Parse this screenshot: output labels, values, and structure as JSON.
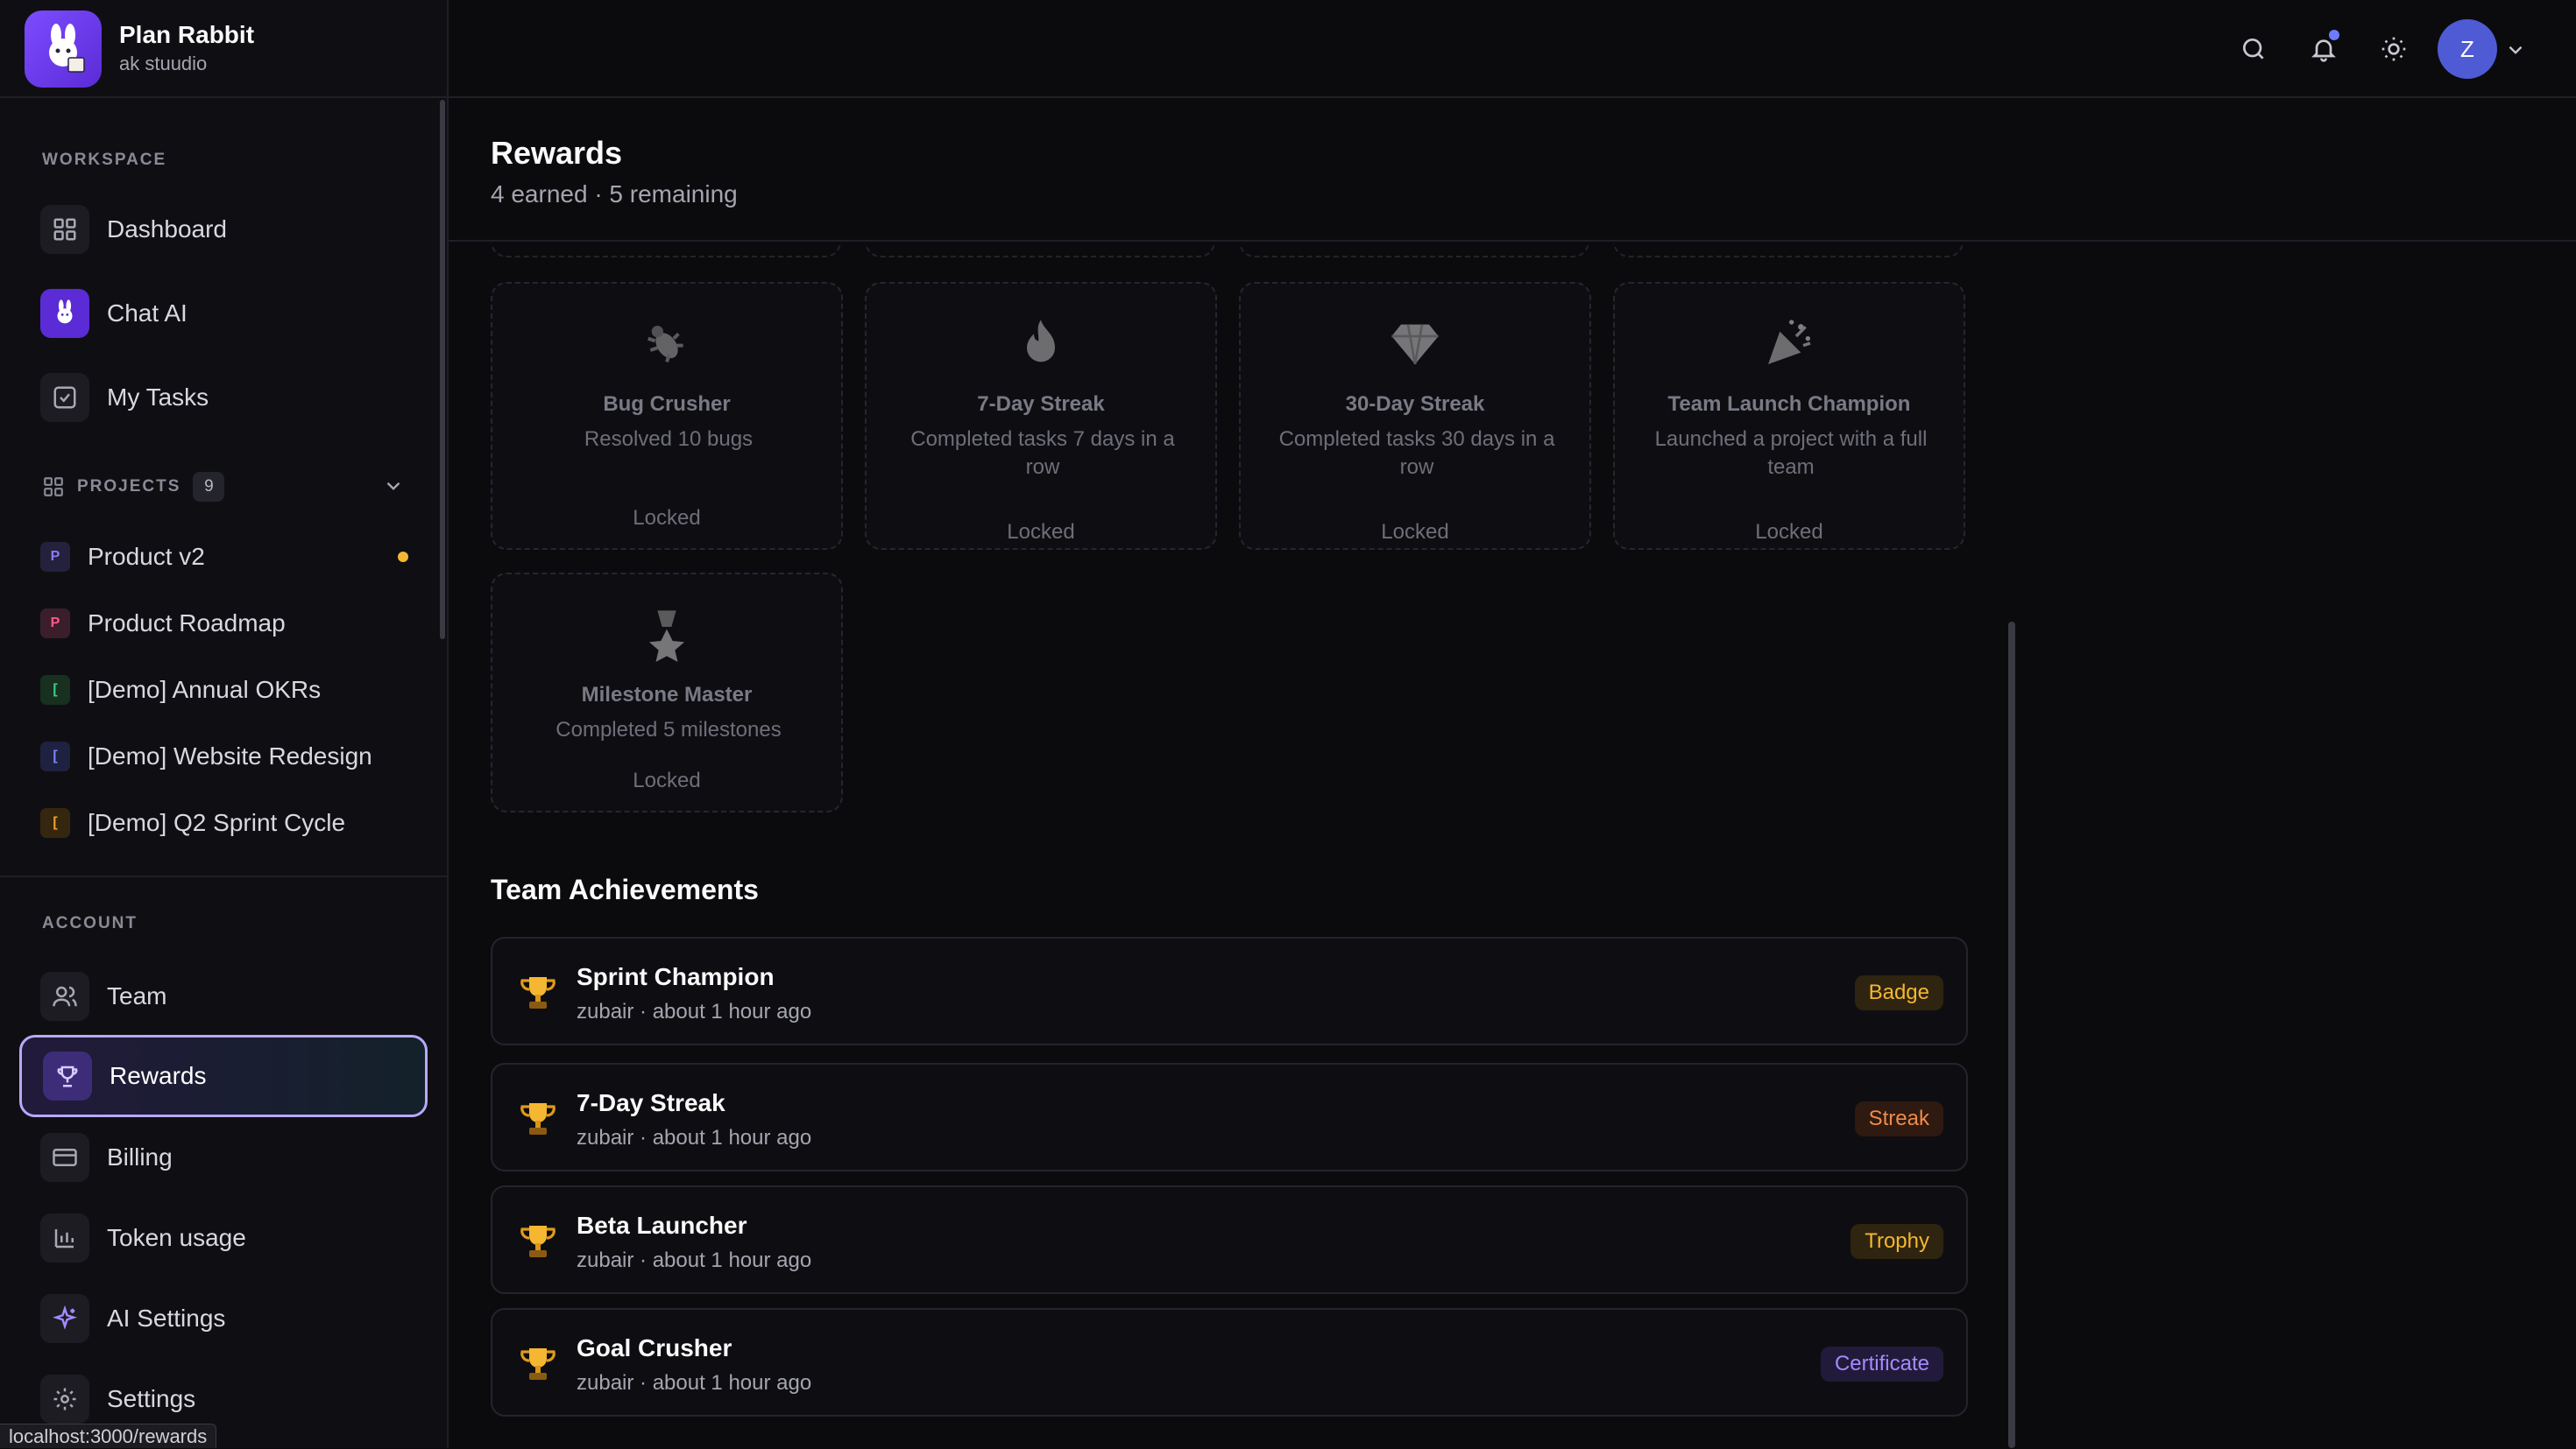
{
  "app": {
    "name": "Plan Rabbit",
    "workspace_name": "ak stuudio"
  },
  "sidebar": {
    "workspace_label": "WORKSPACE",
    "workspace_items": [
      {
        "label": "Dashboard",
        "icon": "grid-icon"
      },
      {
        "label": "Chat AI",
        "icon": "rabbit-icon"
      },
      {
        "label": "My Tasks",
        "icon": "checkbox-icon"
      }
    ],
    "projects_label": "PROJECTS",
    "projects_count": "9",
    "projects": [
      {
        "initial": "P",
        "name": "Product v2",
        "chip_color": "#8b7bff",
        "chip_bg": "#24213d",
        "unread": true
      },
      {
        "initial": "P",
        "name": "Product Roadmap",
        "chip_color": "#ff5a8a",
        "chip_bg": "#3a1f2a",
        "unread": false
      },
      {
        "initial": "[",
        "name": "[Demo] Annual OKRs",
        "chip_color": "#3fd08a",
        "chip_bg": "#17301f",
        "unread": false
      },
      {
        "initial": "[",
        "name": "[Demo] Website Redesign",
        "chip_color": "#7c86ff",
        "chip_bg": "#1f2140",
        "unread": false
      },
      {
        "initial": "[",
        "name": "[Demo] Q2 Sprint Cycle",
        "chip_color": "#f5a524",
        "chip_bg": "#35270f",
        "unread": false
      }
    ],
    "account_label": "ACCOUNT",
    "account_items": [
      {
        "label": "Team",
        "icon": "users-icon"
      },
      {
        "label": "Rewards",
        "icon": "trophy-icon",
        "active": true
      },
      {
        "label": "Billing",
        "icon": "credit-card-icon"
      },
      {
        "label": "Token usage",
        "icon": "bar-chart-icon"
      },
      {
        "label": "AI Settings",
        "icon": "sparkles-icon"
      },
      {
        "label": "Settings",
        "icon": "gear-icon"
      }
    ]
  },
  "status_bar": {
    "url": "localhost:3000/rewards"
  },
  "topbar": {
    "avatar_initial": "Z"
  },
  "page": {
    "title": "Rewards",
    "subtitle": "4 earned · 5 remaining"
  },
  "badges": [
    {
      "title": "Bug Crusher",
      "description": "Resolved 10 bugs",
      "status": "Locked",
      "icon": "bug-icon"
    },
    {
      "title": "7-Day Streak",
      "description": "Completed tasks 7 days in a row",
      "status": "Locked",
      "icon": "fire-icon"
    },
    {
      "title": "30-Day Streak",
      "description": "Completed tasks 30 days in a row",
      "status": "Locked",
      "icon": "diamond-icon"
    },
    {
      "title": "Team Launch Champion",
      "description": "Launched a project with a full team",
      "status": "Locked",
      "icon": "party-popper-icon"
    },
    {
      "title": "Milestone Master",
      "description": "Completed 5 milestones",
      "status": "Locked",
      "icon": "medal-icon"
    }
  ],
  "team_achievements": {
    "title": "Team Achievements",
    "items": [
      {
        "title": "Sprint Champion",
        "meta": "zubair · about 1 hour ago",
        "badge": "Badge",
        "badge_color": "#f5b731",
        "badge_bg": "#2e2410"
      },
      {
        "title": "7-Day Streak",
        "meta": "zubair · about 1 hour ago",
        "badge": "Streak",
        "badge_color": "#f08a4b",
        "badge_bg": "#2e1a10"
      },
      {
        "title": "Beta Launcher",
        "meta": "zubair · about 1 hour ago",
        "badge": "Trophy",
        "badge_color": "#f5b731",
        "badge_bg": "#2e2410"
      },
      {
        "title": "Goal Crusher",
        "meta": "zubair · about 1 hour ago",
        "badge": "Certificate",
        "badge_color": "#a38bff",
        "badge_bg": "#221a3a"
      }
    ]
  }
}
